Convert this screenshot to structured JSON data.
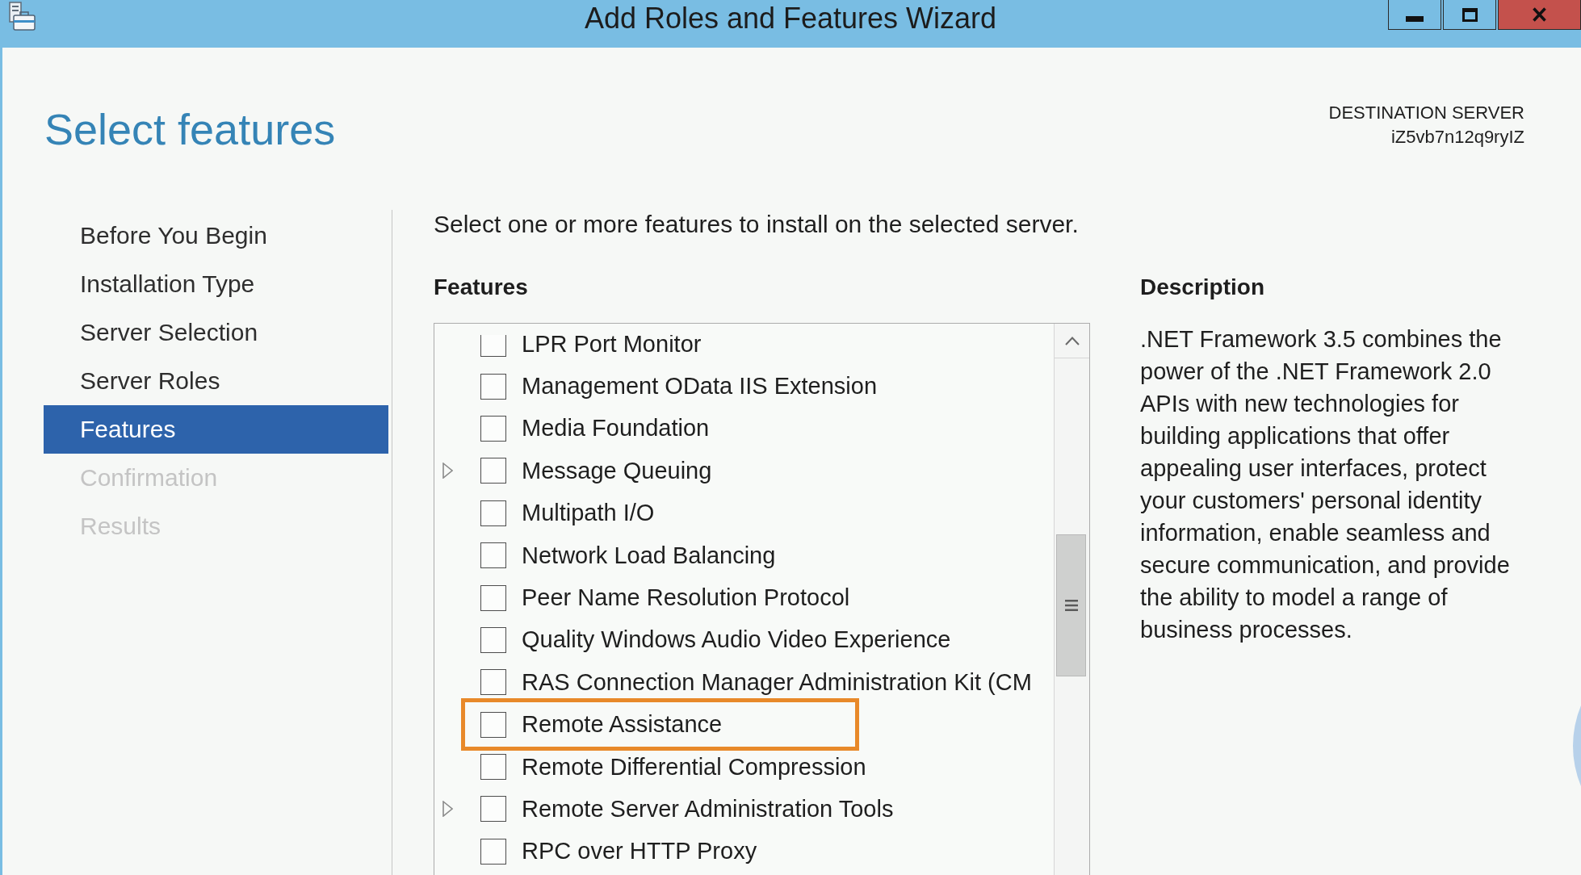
{
  "window": {
    "title": "Add Roles and Features Wizard"
  },
  "page_title": "Select features",
  "destination_server": {
    "label": "DESTINATION SERVER",
    "name": "iZ5vb7n12q9ryIZ"
  },
  "steps": [
    {
      "label": "Before You Begin",
      "selected": false,
      "disabled": false
    },
    {
      "label": "Installation Type",
      "selected": false,
      "disabled": false
    },
    {
      "label": "Server Selection",
      "selected": false,
      "disabled": false
    },
    {
      "label": "Server Roles",
      "selected": false,
      "disabled": false
    },
    {
      "label": "Features",
      "selected": true,
      "disabled": false
    },
    {
      "label": "Confirmation",
      "selected": false,
      "disabled": true
    },
    {
      "label": "Results",
      "selected": false,
      "disabled": true
    }
  ],
  "instruction": "Select one or more features to install on the selected server.",
  "features": {
    "heading": "Features",
    "items": [
      {
        "label": "LPR Port Monitor",
        "checked": false,
        "expandable": false,
        "highlighted": false
      },
      {
        "label": "Management OData IIS Extension",
        "checked": false,
        "expandable": false,
        "highlighted": false
      },
      {
        "label": "Media Foundation",
        "checked": false,
        "expandable": false,
        "highlighted": false
      },
      {
        "label": "Message Queuing",
        "checked": false,
        "expandable": true,
        "highlighted": false
      },
      {
        "label": "Multipath I/O",
        "checked": false,
        "expandable": false,
        "highlighted": false
      },
      {
        "label": "Network Load Balancing",
        "checked": false,
        "expandable": false,
        "highlighted": false
      },
      {
        "label": "Peer Name Resolution Protocol",
        "checked": false,
        "expandable": false,
        "highlighted": false
      },
      {
        "label": "Quality Windows Audio Video Experience",
        "checked": false,
        "expandable": false,
        "highlighted": false
      },
      {
        "label": "RAS Connection Manager Administration Kit (CM",
        "checked": false,
        "expandable": false,
        "highlighted": false
      },
      {
        "label": "Remote Assistance",
        "checked": false,
        "expandable": false,
        "highlighted": true
      },
      {
        "label": "Remote Differential Compression",
        "checked": false,
        "expandable": false,
        "highlighted": false
      },
      {
        "label": "Remote Server Administration Tools",
        "checked": false,
        "expandable": true,
        "highlighted": false
      },
      {
        "label": "RPC over HTTP Proxy",
        "checked": false,
        "expandable": false,
        "highlighted": false
      }
    ]
  },
  "description": {
    "heading": "Description",
    "text": ".NET Framework 3.5 combines the power of the .NET Framework 2.0 APIs with new technologies for building applications that offer appealing user interfaces, protect your customers' personal identity information, enable seamless and secure communication, and provide the ability to model a range of business processes."
  }
}
